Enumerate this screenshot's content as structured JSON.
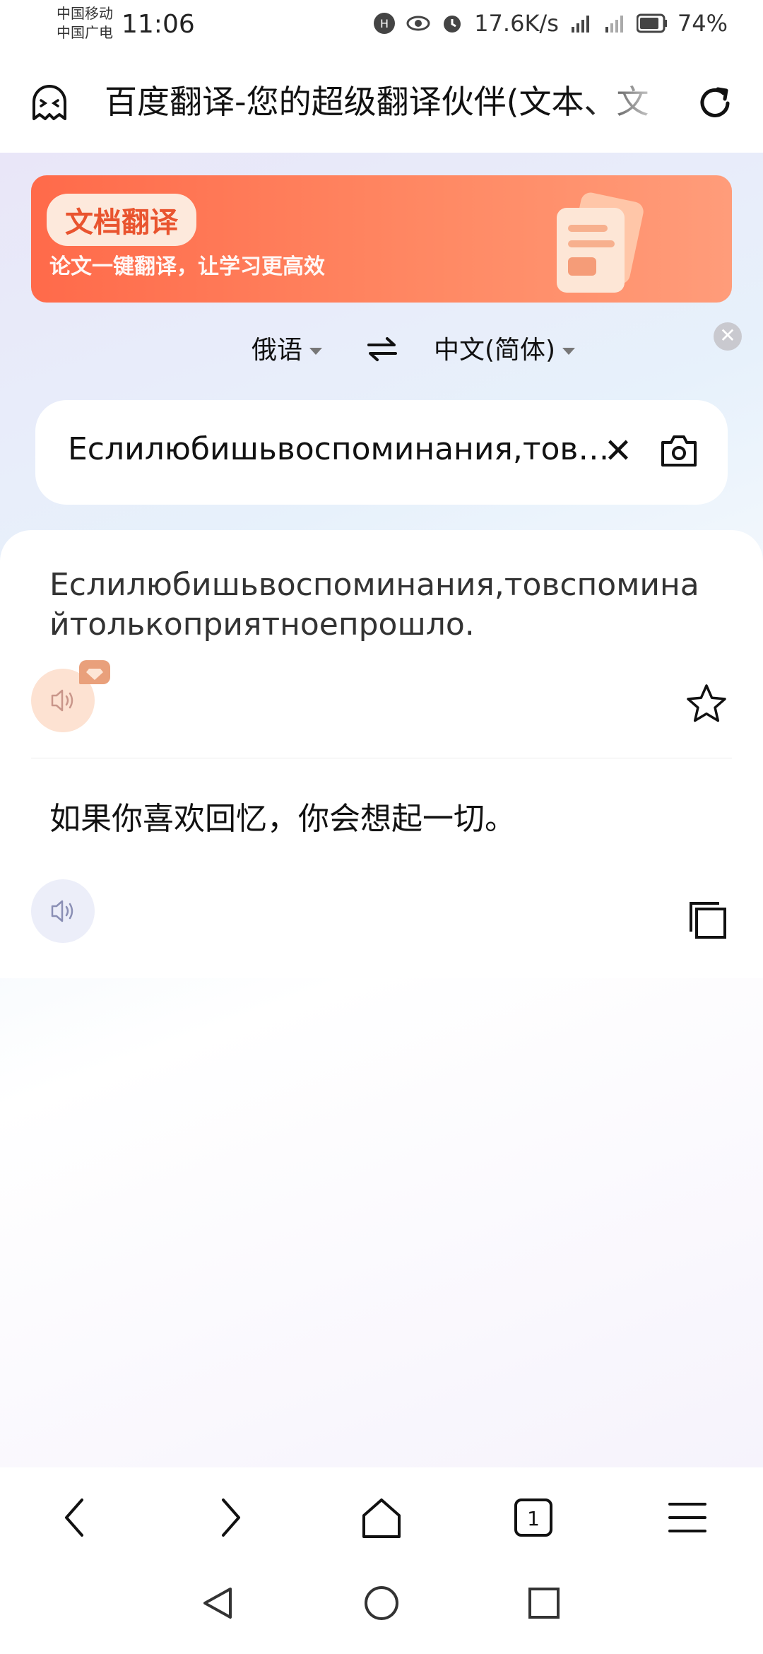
{
  "status": {
    "carrier1": "中国移动",
    "carrier2": "中国广电",
    "time": "11:06",
    "speed": "17.6K/s",
    "battery": "74%"
  },
  "browser": {
    "title": "百度翻译-您的超级翻译伙伴(文本、文"
  },
  "banner": {
    "tag": "文档翻译",
    "subtitle": "论文一键翻译，让学习更高效"
  },
  "languages": {
    "source": "俄语",
    "target": "中文(简体)"
  },
  "input": {
    "value": "Еслилюбишьвоспоминания,товспоминайтолькоприятноепрошло."
  },
  "result": {
    "source_text": "Еслилюбишьвоспоминания,товспоминайтолькоприятноепрошло.",
    "translation": "如果你喜欢回忆，你会想起一切。"
  },
  "colors": {
    "accent": "#ff6a4a",
    "banner_tag_text": "#e9542f"
  },
  "icons": [
    "ghost-icon",
    "reload-icon",
    "document-icon",
    "close-icon",
    "swap-icon",
    "camera-icon",
    "speaker-icon",
    "vip-icon",
    "star-icon",
    "copy-icon",
    "back-icon",
    "forward-icon",
    "home-icon",
    "tabs-icon",
    "menu-icon"
  ]
}
